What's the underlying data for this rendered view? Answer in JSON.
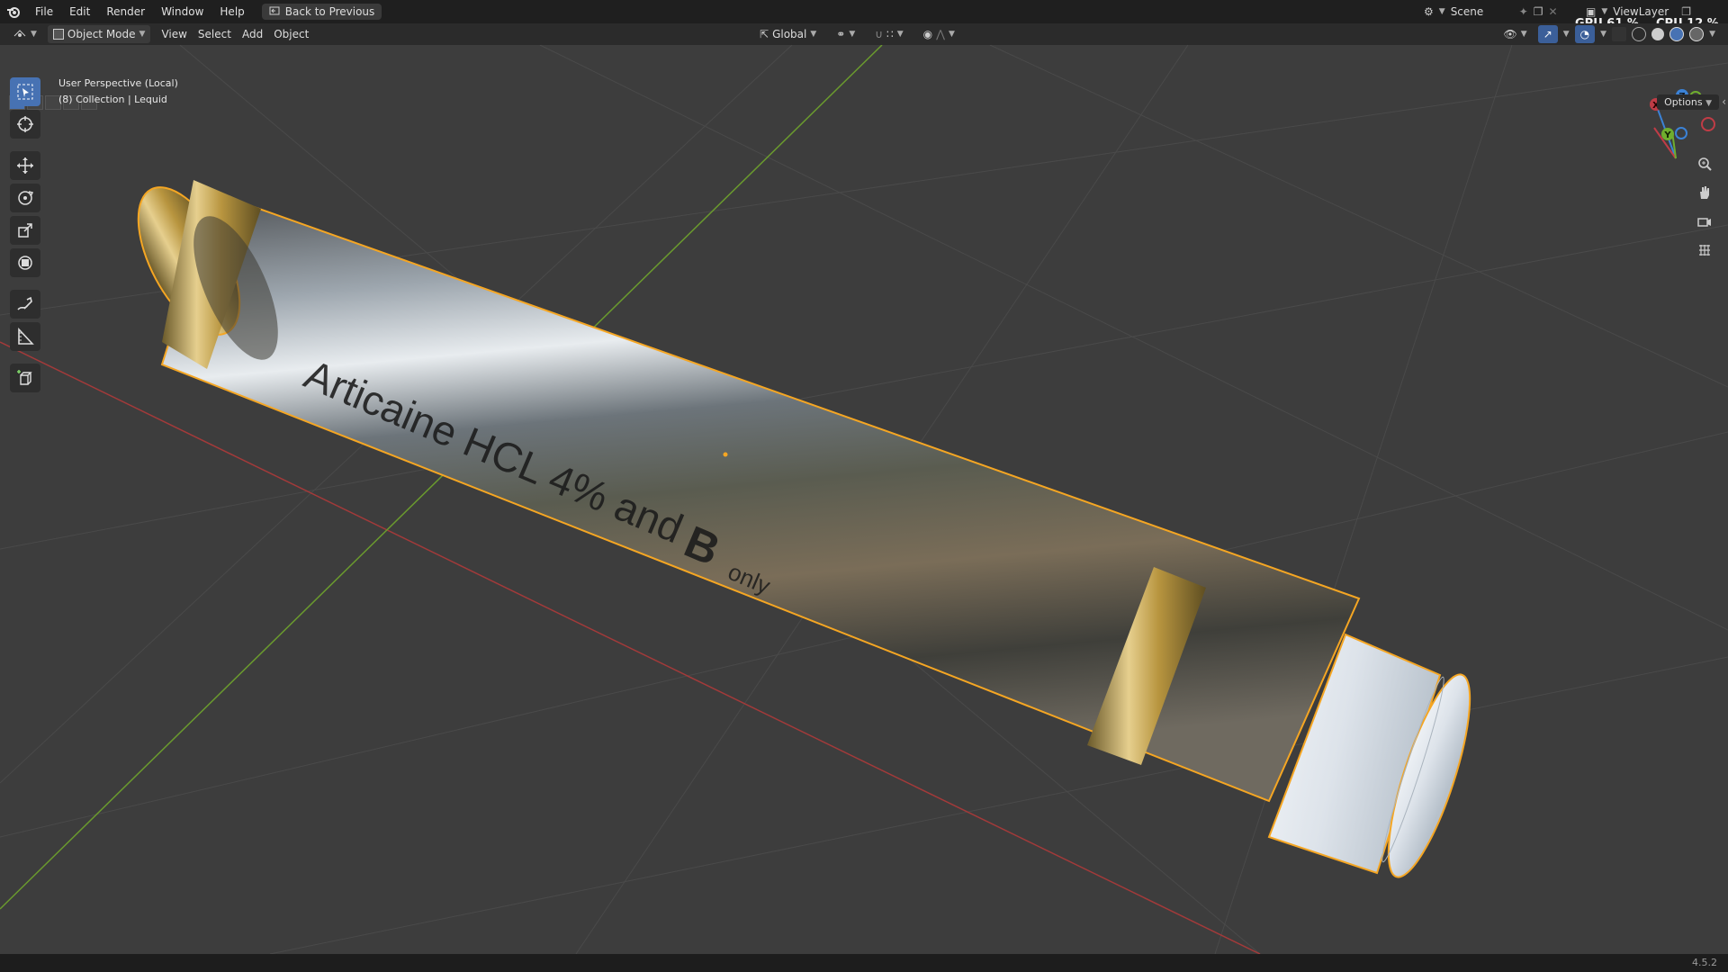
{
  "topbar": {
    "menus": [
      "File",
      "Edit",
      "Render",
      "Window",
      "Help"
    ],
    "back_label": "Back to Previous",
    "scene_label": "Scene",
    "viewlayer_label": "ViewLayer",
    "gpu_label": "GPU",
    "gpu_value": "61 %",
    "cpu_label": "CPU",
    "cpu_value": "12 %"
  },
  "header": {
    "mode": "Object Mode",
    "menus": [
      "View",
      "Select",
      "Add",
      "Object"
    ],
    "orientation": "Global",
    "options_label": "Options"
  },
  "viewport": {
    "perspective_label": "User Perspective (Local)",
    "collection_label": "(8) Collection | Lequid",
    "model_text_1": "Articaine HCL 4% and",
    "model_text_2": "B",
    "model_text_3": "only",
    "gizmo": {
      "x": "X",
      "y": "Y",
      "z": "Z"
    }
  },
  "toolbar": {
    "tools": [
      "select-box",
      "cursor",
      "move",
      "rotate",
      "scale",
      "transform",
      "annotate",
      "measure",
      "add-cube"
    ],
    "active_tool": "select-box"
  },
  "statusbar": {
    "version": "4.5.2"
  },
  "colors": {
    "accent": "#4772b3",
    "outline": "#f5a623",
    "grid_x_axis": "#a33a3a",
    "grid_y_axis": "#6a9a2e",
    "background": "#3d3d3d"
  }
}
